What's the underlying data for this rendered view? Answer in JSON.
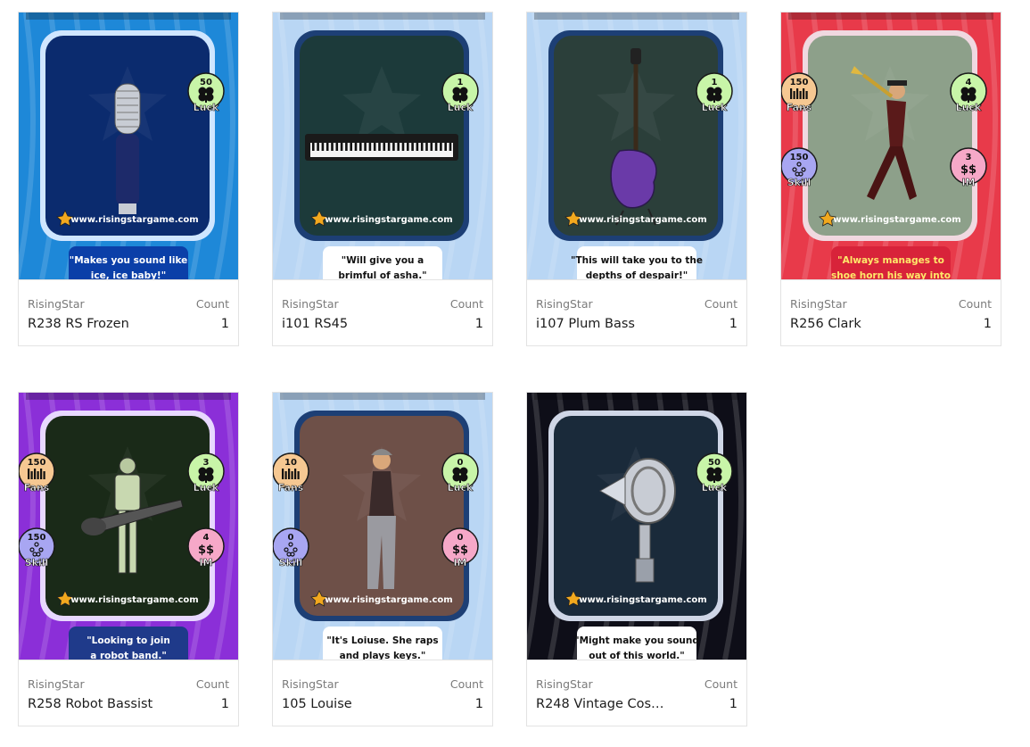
{
  "cards": [
    {
      "collection": "RisingStar",
      "count_label": "Count",
      "name": "R238 RS Frozen",
      "count": "1",
      "quote": [
        "\"Makes you sound like",
        "ice, ice baby!\""
      ],
      "site": "www.risingstargame.com",
      "stats": [
        {
          "value": "50",
          "label": "Luck",
          "color": "#c8f5a8",
          "glyph": "clover",
          "side": "right",
          "row": 1
        }
      ],
      "item": "microphone",
      "theme": {
        "bg": "#1e88d8",
        "frame": "#cfe6ff",
        "panel": "#0b2b6e",
        "quote_bg": "#0b3fa8",
        "quote_fg": "#ffffff"
      }
    },
    {
      "collection": "RisingStar",
      "count_label": "Count",
      "name": "i101 RS45",
      "count": "1",
      "quote": [
        "\"Will give you a",
        "brimful of asha.\""
      ],
      "site": "www.risingstargame.com",
      "stats": [
        {
          "value": "1",
          "label": "Luck",
          "color": "#c8f5a8",
          "glyph": "clover",
          "side": "right",
          "row": 1
        }
      ],
      "item": "keyboard",
      "theme": {
        "bg": "#b9d6f4",
        "frame": "#1d3f75",
        "panel": "#1c3a3a",
        "quote_bg": "#ffffff",
        "quote_fg": "#111111"
      }
    },
    {
      "collection": "RisingStar",
      "count_label": "Count",
      "name": "i107 Plum Bass",
      "count": "1",
      "quote": [
        "\"This will take you to the",
        "depths of despair!\""
      ],
      "site": "www.risingstargame.com",
      "stats": [
        {
          "value": "1",
          "label": "Luck",
          "color": "#c8f5a8",
          "glyph": "clover",
          "side": "right",
          "row": 1
        }
      ],
      "item": "bass",
      "theme": {
        "bg": "#b9d6f4",
        "frame": "#1d3f75",
        "panel": "#2b3f3a",
        "quote_bg": "#ffffff",
        "quote_fg": "#111111"
      }
    },
    {
      "collection": "RisingStar",
      "count_label": "Count",
      "name": "R256 Clark",
      "count": "1",
      "quote": [
        "\"Always manages to",
        "shoe horn his way into"
      ],
      "site": "www.risingstargame.com",
      "stats": [
        {
          "value": "150",
          "label": "Fans",
          "color": "#f6c892",
          "glyph": "crowd",
          "side": "left",
          "row": 1
        },
        {
          "value": "4",
          "label": "Luck",
          "color": "#c8f5a8",
          "glyph": "clover",
          "side": "right",
          "row": 1
        },
        {
          "value": "150",
          "label": "Skill",
          "color": "#a8a6f2",
          "glyph": "dots",
          "side": "left",
          "row": 2
        },
        {
          "value": "3",
          "label": "IM",
          "color": "#f6a8c8",
          "glyph": "money",
          "side": "right",
          "row": 2
        }
      ],
      "item": "trumpeter",
      "theme": {
        "bg": "#e83a4a",
        "frame": "#f0d8e0",
        "panel": "#8da08a",
        "quote_bg": "#d8233a",
        "quote_fg": "#ffe86a"
      }
    },
    {
      "collection": "RisingStar",
      "count_label": "Count",
      "name": "R258 Robot Bassist",
      "count": "1",
      "quote": [
        "\"Looking to join",
        "a robot band.\""
      ],
      "site": "www.risingstargame.com",
      "stats": [
        {
          "value": "150",
          "label": "Fans",
          "color": "#f6c892",
          "glyph": "crowd",
          "side": "left",
          "row": 1
        },
        {
          "value": "3",
          "label": "Luck",
          "color": "#c8f5a8",
          "glyph": "clover",
          "side": "right",
          "row": 1
        },
        {
          "value": "150",
          "label": "Skill",
          "color": "#a8a6f2",
          "glyph": "dots",
          "side": "left",
          "row": 2
        },
        {
          "value": "4",
          "label": "IM",
          "color": "#f6a8c8",
          "glyph": "money",
          "side": "right",
          "row": 2
        }
      ],
      "item": "robot",
      "theme": {
        "bg": "#8b2fd8",
        "frame": "#e8d8ff",
        "panel": "#1a2a18",
        "quote_bg": "#1f3a8a",
        "quote_fg": "#ffffff"
      }
    },
    {
      "collection": "RisingStar",
      "count_label": "Count",
      "name": "105 Louise",
      "count": "1",
      "quote": [
        "\"It's Loiuse. She raps",
        "and plays keys.\""
      ],
      "site": "www.risingstargame.com",
      "stats": [
        {
          "value": "10",
          "label": "Fans",
          "color": "#f6c892",
          "glyph": "crowd",
          "side": "left",
          "row": 1
        },
        {
          "value": "0",
          "label": "Luck",
          "color": "#c8f5a8",
          "glyph": "clover",
          "side": "right",
          "row": 1
        },
        {
          "value": "0",
          "label": "Skill",
          "color": "#a8a6f2",
          "glyph": "dots",
          "side": "left",
          "row": 2
        },
        {
          "value": "0",
          "label": "IM",
          "color": "#f6a8c8",
          "glyph": "money",
          "side": "right",
          "row": 2
        }
      ],
      "item": "louise",
      "theme": {
        "bg": "#b9d6f4",
        "frame": "#1d3f75",
        "panel": "#6e5048",
        "quote_bg": "#ffffff",
        "quote_fg": "#111111"
      }
    },
    {
      "collection": "RisingStar",
      "count_label": "Count",
      "name": "R248 Vintage Cos…",
      "count": "1",
      "quote": [
        "\"Might make you sound",
        "out of this world.\""
      ],
      "site": "www.risingstargame.com",
      "stats": [
        {
          "value": "50",
          "label": "Luck",
          "color": "#c8f5a8",
          "glyph": "clover",
          "side": "right",
          "row": 1
        }
      ],
      "item": "vintagemic",
      "theme": {
        "bg": "#0e0e18",
        "frame": "#cfd6e6",
        "panel": "#1a2a3a",
        "quote_bg": "#ffffff",
        "quote_fg": "#111111"
      }
    }
  ]
}
